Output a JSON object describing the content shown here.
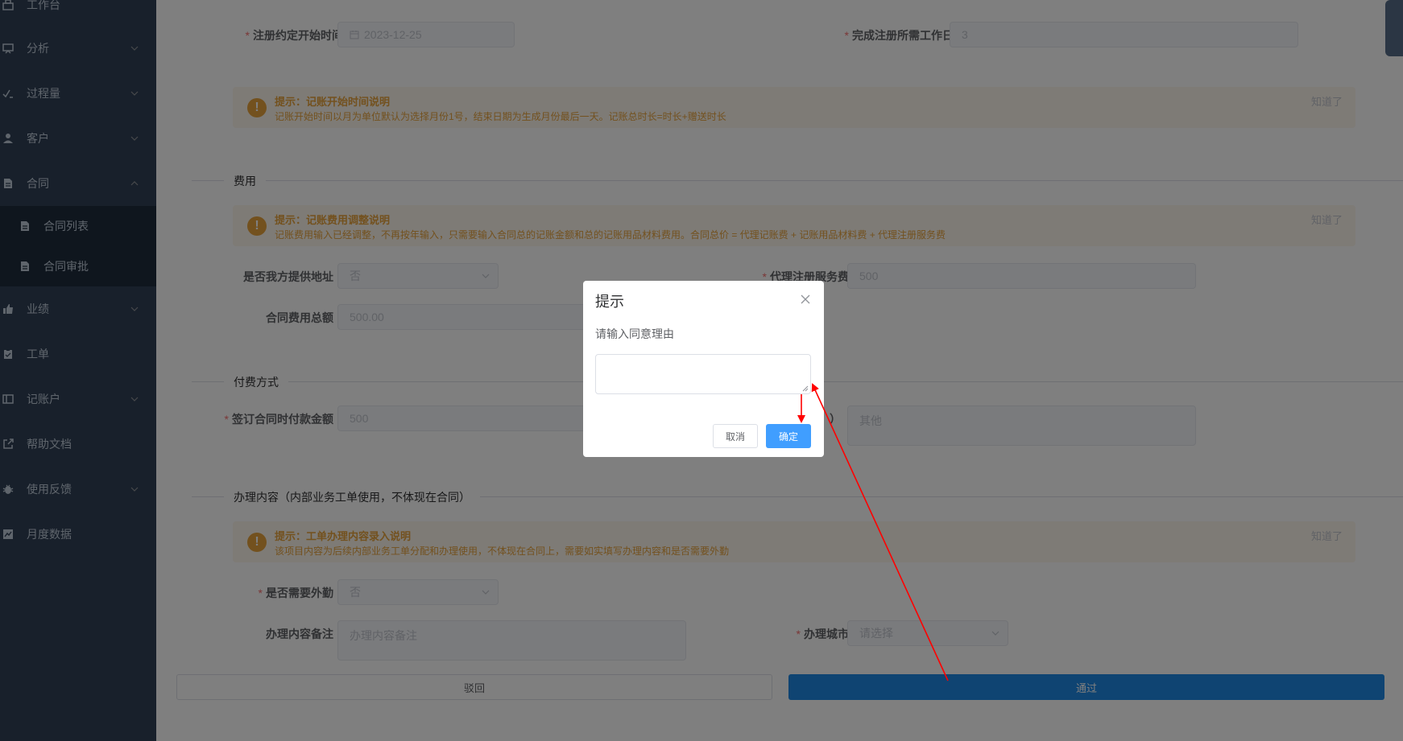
{
  "sidebar": {
    "items": [
      {
        "label": "工作台",
        "icon": "dashboard-icon",
        "arrow": false
      },
      {
        "label": "分析",
        "icon": "chart-board-icon",
        "arrow": true
      },
      {
        "label": "过程量",
        "icon": "checklist-icon",
        "arrow": true
      },
      {
        "label": "客户",
        "icon": "user-icon",
        "arrow": true
      },
      {
        "label": "合同",
        "icon": "document-icon",
        "arrow": true,
        "expanded": true
      },
      {
        "label": "业绩",
        "icon": "thumbs-up-icon",
        "arrow": true
      },
      {
        "label": "工单",
        "icon": "clipboard-icon",
        "arrow": false
      },
      {
        "label": "记账户",
        "icon": "ledger-icon",
        "arrow": true
      },
      {
        "label": "帮助文档",
        "icon": "external-link-icon",
        "arrow": false
      },
      {
        "label": "使用反馈",
        "icon": "bug-icon",
        "arrow": true
      },
      {
        "label": "月度数据",
        "icon": "line-chart-icon",
        "arrow": false
      }
    ],
    "submenu": [
      {
        "label": "合同列表",
        "icon": "document-icon"
      },
      {
        "label": "合同审批",
        "icon": "document-icon"
      }
    ]
  },
  "form": {
    "register_start_label": "注册约定开始时间",
    "register_start_value": "2023-12-25",
    "workdays_label": "完成注册所需工作日",
    "workdays_value": "3",
    "alert1": {
      "title": "提示：记账开始时间说明",
      "desc": "记账开始时间以月为单位默认为选择月份1号，结束日期为生成月份最后一天。记账总时长=时长+赠送时长",
      "close": "知道了"
    },
    "fee_section": "费用",
    "alert2": {
      "title": "提示：记账费用调整说明",
      "desc": "记账费用输入已经调整，不再按年输入，只需要输入合同总的记账金额和总的记账用品材料费用。合同总价 = 代理记账费 + 记账用品材料费 + 代理注册服务费",
      "close": "知道了"
    },
    "address_label": "是否我方提供地址",
    "address_value": "否",
    "agent_fee_label": "代理注册服务费",
    "agent_fee_value": "500",
    "total_label": "合同费用总额",
    "total_value": "500.00",
    "payment_section": "付费方式",
    "sign_pay_label": "签订合同时付款金额",
    "sign_pay_value": "500",
    "other_label_tail": "）",
    "other_placeholder": "其他",
    "work_section": "办理内容（内部业务工单使用，不体现在合同）",
    "alert3": {
      "title": "提示：工单办理内容录入说明",
      "desc": "该项目内容为后续内部业务工单分配和办理使用，不体现在合同上，需要如实填写办理内容和是否需要外勤",
      "close": "知道了"
    },
    "field_work_label": "是否需要外勤",
    "field_work_value": "否",
    "remark_label": "办理内容备注",
    "remark_placeholder": "办理内容备注",
    "city_label": "办理城市",
    "city_placeholder": "请选择",
    "reject_button": "驳回",
    "approve_button": "通过"
  },
  "dialog": {
    "title": "提示",
    "message": "请输入同意理由",
    "input_value": "",
    "cancel": "取消",
    "confirm": "确定"
  },
  "colors": {
    "sidebar_bg": "#304156",
    "submenu_bg": "#1f2d3d",
    "primary": "#409eff",
    "approve_bg": "#1e88e5",
    "warning": "#e6a23c",
    "required": "#f56c6c",
    "annotation": "#ff0000"
  }
}
